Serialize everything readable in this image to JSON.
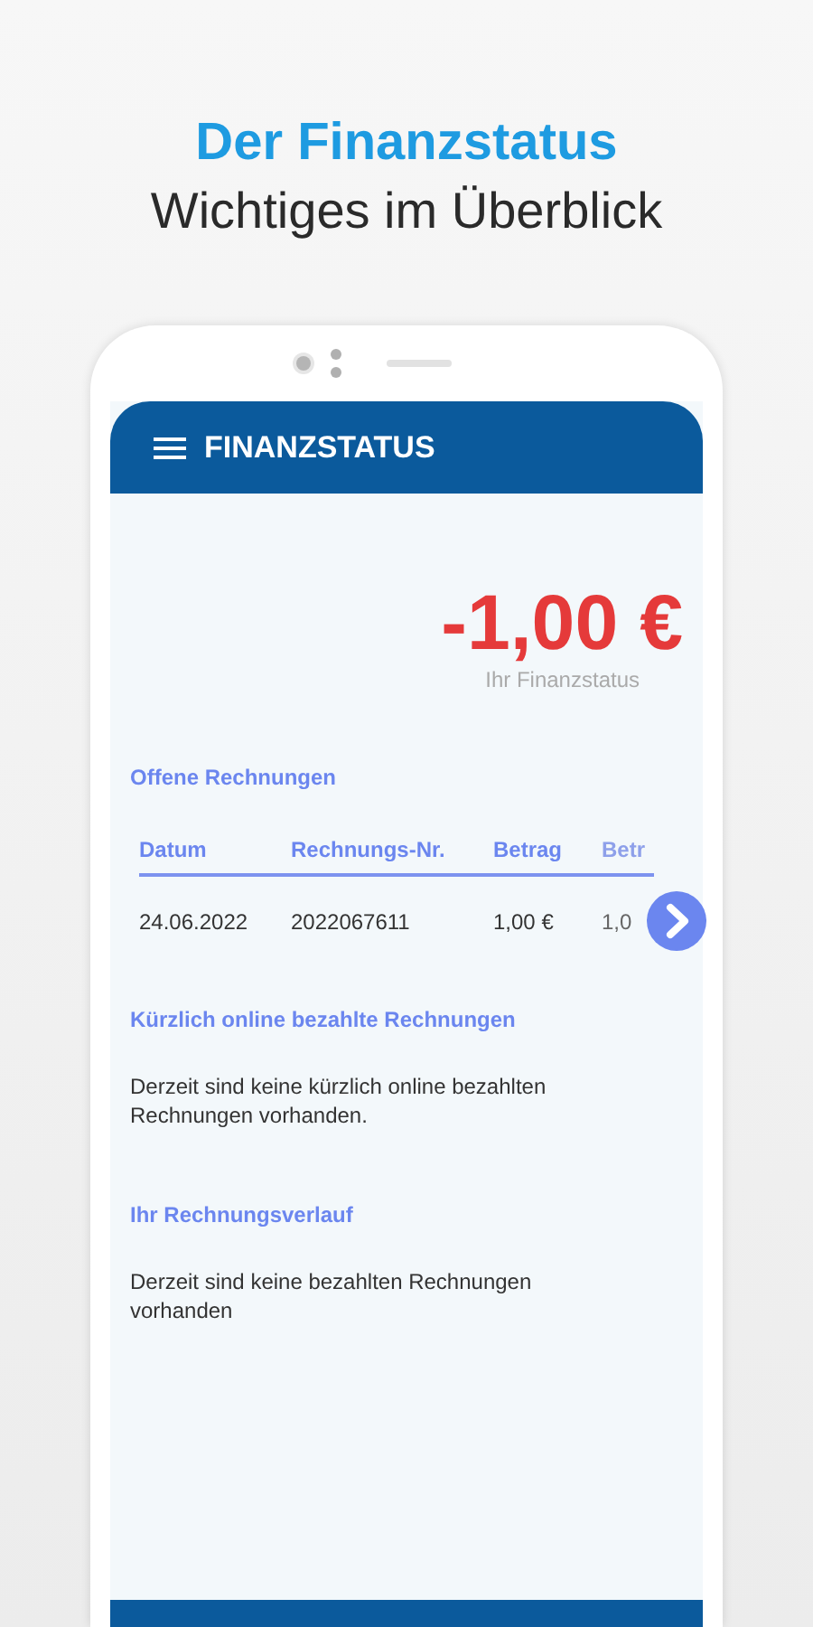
{
  "headline": {
    "title": "Der Finanzstatus",
    "subtitle": "Wichtiges im Überblick"
  },
  "app_bar": {
    "title": "FINANZSTATUS"
  },
  "balance": {
    "amount": "-1,00 €",
    "label": "Ihr Finanzstatus"
  },
  "open_invoices": {
    "heading": "Offene Rechnungen",
    "columns": [
      "Datum",
      "Rechnungs-Nr.",
      "Betrag",
      "Betr"
    ],
    "rows": [
      [
        "24.06.2022",
        "2022067611",
        "1,00 €",
        "1,0"
      ]
    ]
  },
  "sections": [
    {
      "heading": "Kürzlich online bezahlte Rechnungen",
      "text": "Derzeit sind keine kürzlich online bezahlten Rechnungen vorhanden."
    },
    {
      "heading": "Ihr Rechnungsverlauf",
      "text": "Derzeit sind keine bezahlten Rechnungen vorhanden"
    }
  ]
}
